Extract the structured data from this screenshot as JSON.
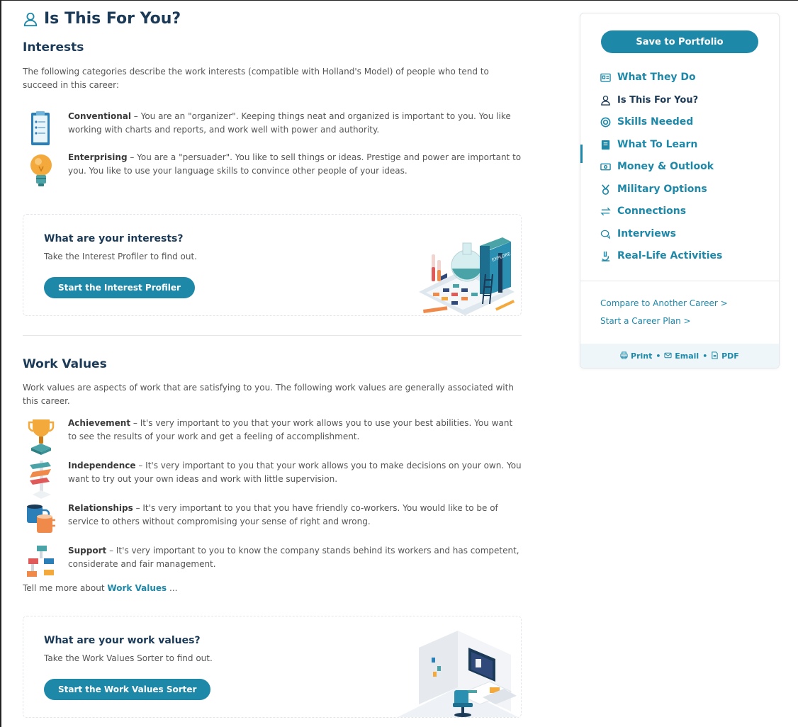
{
  "page": {
    "title": "Is This For You?"
  },
  "interests": {
    "heading": "Interests",
    "intro": "The following categories describe the work interests (compatible with Holland's Model) of people who tend to succeed in this career:",
    "items": [
      {
        "name": "Conventional",
        "desc": " – You are an \"organizer\". Keeping things neat and organized is important to you. You like working with charts and reports, and work well with power and authority.",
        "icon": "clipboard-icon"
      },
      {
        "name": "Enterprising",
        "desc": " – You are a \"persuader\". You like to sell things or ideas. Prestige and power are important to you. You like to use your language skills to convince other people of your ideas.",
        "icon": "lightbulb-icon"
      }
    ],
    "cta": {
      "title": "What are your interests?",
      "subtitle": "Take the Interest Profiler to find out.",
      "button": "Start the Interest Profiler"
    }
  },
  "work_values": {
    "heading": "Work Values",
    "intro": "Work values are aspects of work that are satisfying to you. The following work values are generally associated with this career.",
    "items": [
      {
        "name": "Achievement",
        "desc": " – It's very important to you that your work allows you to use your best abilities. You want to see the results of your work and get a feeling of accomplishment.",
        "icon": "trophy-icon"
      },
      {
        "name": "Independence",
        "desc": " – It's very important to you that your work allows you to make decisions on your own. You want to try out your own ideas and work with little supervision.",
        "icon": "signpost-icon"
      },
      {
        "name": "Relationships",
        "desc": " – It's very important to you that you have friendly co-workers. You would like to be of service to others without compromising your sense of right and wrong.",
        "icon": "cups-icon"
      },
      {
        "name": "Support",
        "desc": " – It's very important to you to know the company stands behind its workers and has competent, considerate and fair management.",
        "icon": "org-chart-icon"
      }
    ],
    "more_prefix": "Tell me more about ",
    "more_link": "Work Values",
    "more_suffix": " ...",
    "cta": {
      "title": "What are your work values?",
      "subtitle": "Take the Work Values Sorter to find out.",
      "button": "Start the Work Values Sorter"
    }
  },
  "sidebar": {
    "save": "Save to Portfolio",
    "nav": [
      {
        "label": "What They Do",
        "icon": "id-card-icon"
      },
      {
        "label": "Is This For You?",
        "icon": "person-icon",
        "active": true
      },
      {
        "label": "Skills Needed",
        "icon": "target-icon"
      },
      {
        "label": "What To Learn",
        "icon": "book-icon"
      },
      {
        "label": "Money & Outlook",
        "icon": "money-icon"
      },
      {
        "label": "Military Options",
        "icon": "medal-icon"
      },
      {
        "label": "Connections",
        "icon": "arrows-icon"
      },
      {
        "label": "Interviews",
        "icon": "chat-icon"
      },
      {
        "label": "Real-Life Activities",
        "icon": "microscope-icon"
      }
    ],
    "links": [
      "Compare to Another Career >",
      "Start a Career Plan >"
    ],
    "footer": {
      "print": "Print",
      "email": "Email",
      "pdf": "PDF",
      "sep": "•"
    }
  },
  "colors": {
    "accent": "#1e88a8",
    "heading": "#1b3a57",
    "text": "#555555"
  }
}
